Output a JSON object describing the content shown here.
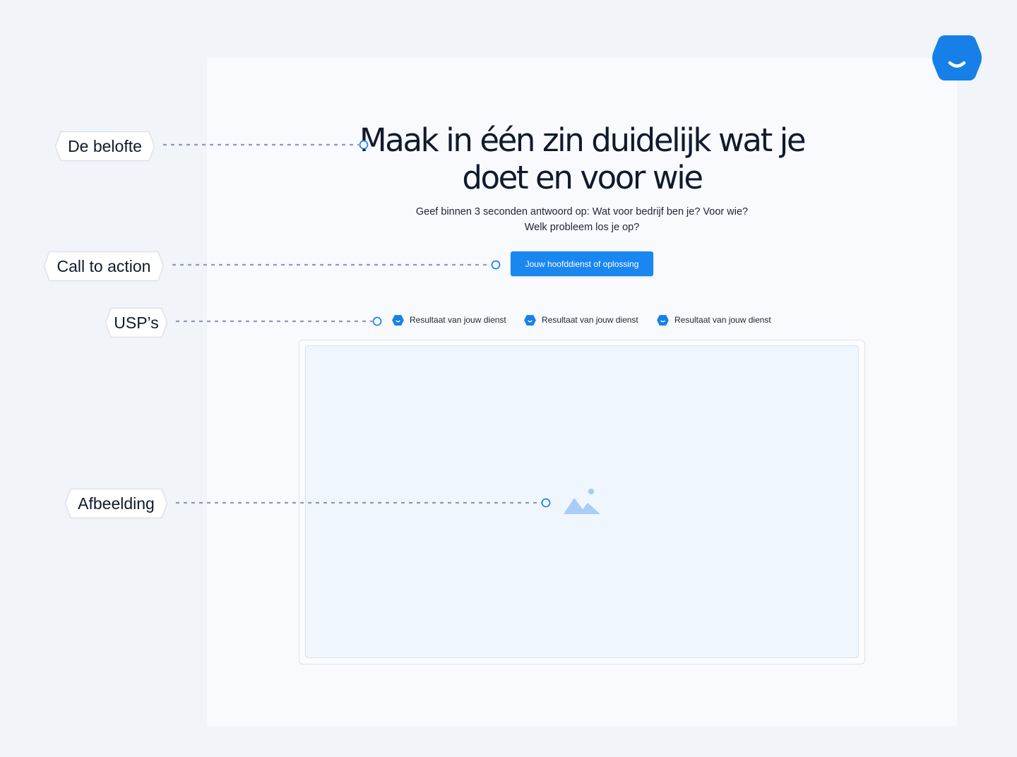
{
  "headline": {
    "line1": "Maak in één zin duidelijk wat je",
    "line2": "doet en voor wie"
  },
  "subtitle": {
    "line1": "Geef binnen 3 seconden antwoord op: Wat voor bedrijf ben je? Voor wie?",
    "line2": "Welk probleem los je op?"
  },
  "cta": {
    "label": "Jouw hoofddienst of oplossing"
  },
  "usps": [
    {
      "label": "Resultaat van jouw dienst"
    },
    {
      "label": "Resultaat van jouw dienst"
    },
    {
      "label": "Resultaat van jouw dienst"
    }
  ],
  "annotations": {
    "promise": "De belofte",
    "cta": "Call to action",
    "usps": "USP’s",
    "image": "Afbeelding"
  },
  "icons": {
    "brand": "hexagon-smile-logo",
    "usp": "hexagon-smile-icon",
    "image": "image-placeholder-icon"
  },
  "colors": {
    "accent": "#1a86f0",
    "background": "#f1f4f8",
    "page": "#f8fafd",
    "text": "#111a2c",
    "connector": "#8e9bb0"
  }
}
